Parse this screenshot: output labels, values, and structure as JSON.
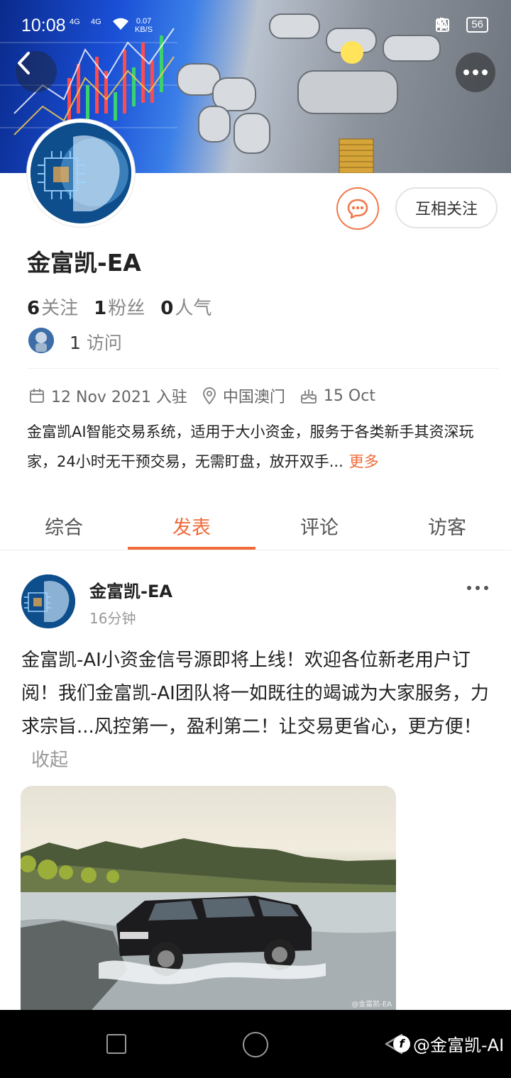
{
  "status_bar": {
    "time": "10:08",
    "signal1": "4G",
    "signal2": "4G",
    "speed_value": "0.07",
    "speed_unit": "KB/S",
    "nfc": "N",
    "battery": "56"
  },
  "profile": {
    "username": "金富凯-EA",
    "follow_button": "互相关注",
    "stats": [
      {
        "value": "6",
        "label": "关注"
      },
      {
        "value": "1",
        "label": "粉丝"
      },
      {
        "value": "0",
        "label": "人气"
      }
    ],
    "visits_value": "1",
    "visits_label": "访问",
    "joined": "12 Nov 2021 入驻",
    "location": "中国澳门",
    "birthday": "15 Oct",
    "bio": "金富凯AI智能交易系统，适用于大小资金，服务于各类新手其资深玩家，24小时无干预交易，无需盯盘，放开双手...",
    "bio_more": "更多"
  },
  "tabs": [
    {
      "label": "综合",
      "active": false
    },
    {
      "label": "发表",
      "active": true
    },
    {
      "label": "评论",
      "active": false
    },
    {
      "label": "访客",
      "active": false
    }
  ],
  "post": {
    "author": "金富凯-EA",
    "time": "16分钟",
    "text": "金富凯-AI小资金信号源即将上线！欢迎各位新老用户订阅！我们金富凯-AI团队将一如既往的竭诚为大家服务，力求宗旨...风控第一，盈利第二！让交易更省心，更方便！",
    "collapse": "收起",
    "image_watermark": "@金富凯-EA"
  },
  "watermark": "@金富凯-AI",
  "colors": {
    "accent": "#f06b3a",
    "text_primary": "#222222",
    "text_secondary": "#888888"
  }
}
